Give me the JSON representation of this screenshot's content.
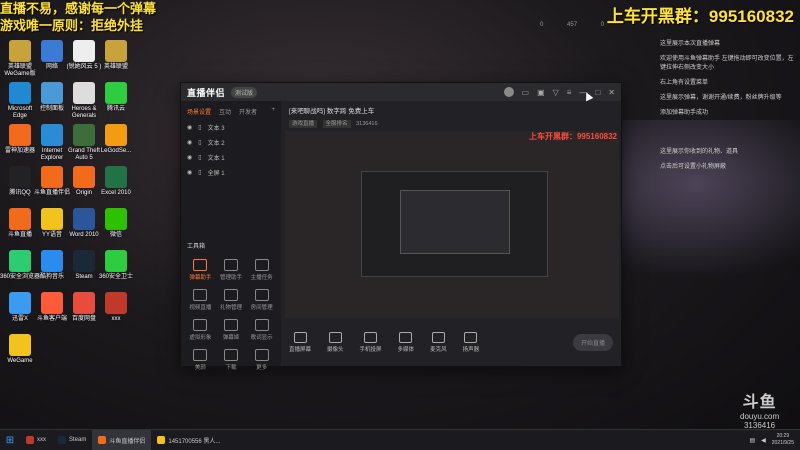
{
  "overlay": {
    "top_left_line1": "直播不易，感谢每一个弹幕",
    "top_left_line2": "游戏唯一原则：拒绝外挂",
    "top_right": "上车开黑群：995160832"
  },
  "stream_stats": [
    "0",
    "457",
    "0"
  ],
  "desktop_icons": [
    {
      "label": "英雄联盟 WeGame版",
      "color": "#c8a23a"
    },
    {
      "label": "网络",
      "color": "#3a7bd5"
    },
    {
      "label": "(锐她风云 5 )",
      "color": "#eeeeee"
    },
    {
      "label": "英雄联盟",
      "color": "#c8a23a"
    },
    {
      "label": "Microsoft Edge",
      "color": "#1f8ad2"
    },
    {
      "label": "控制面板",
      "color": "#4a9ad8"
    },
    {
      "label": "Heroes & Generals",
      "color": "#dddddd"
    },
    {
      "label": "腾讯云",
      "color": "#2ecc40"
    },
    {
      "label": "雷神加速器",
      "color": "#f26b1d"
    },
    {
      "label": "Internet Explorer",
      "color": "#2a8bd6"
    },
    {
      "label": "Grand Theft Auto 5",
      "color": "#3b6e3b"
    },
    {
      "label": "LeGodSe...",
      "color": "#f39c12"
    },
    {
      "label": "腾讯QQ",
      "color": "#222222"
    },
    {
      "label": "斗鱼直播伴侣",
      "color": "#f26b1d"
    },
    {
      "label": "Origin",
      "color": "#f26b1d"
    },
    {
      "label": "Excel 2010",
      "color": "#217346"
    },
    {
      "label": "斗鱼直播",
      "color": "#f26b1d"
    },
    {
      "label": "YY语音",
      "color": "#f2c21d"
    },
    {
      "label": "Word 2010",
      "color": "#2b579a"
    },
    {
      "label": "微信",
      "color": "#2dc100"
    },
    {
      "label": "360安全浏览器",
      "color": "#2ecc71"
    },
    {
      "label": "酷狗音乐",
      "color": "#2b8cf0"
    },
    {
      "label": "Steam",
      "color": "#1b2838"
    },
    {
      "label": "360安全卫士",
      "color": "#2ecc40"
    },
    {
      "label": "迅雷X",
      "color": "#3a9bf0"
    },
    {
      "label": "斗鱼客户端",
      "color": "#ff5a3a"
    },
    {
      "label": "百度网盘",
      "color": "#e74c3c"
    },
    {
      "label": "xxx",
      "color": "#c0392b"
    },
    {
      "label": "WeGame",
      "color": "#f2c21d"
    }
  ],
  "chat_panel": [
    "这里展示本次直播弹幕",
    "欢迎使用斗鱼弹幕助手 左键拖动即可改变位置，左键拉伸右侧改变大小",
    "右上角有设置菜单",
    "这里展示弹幕，谢谢开通/续费，粉丝牌升级等",
    "添加弹幕助手成功",
    "这里展示你收到的礼物、道具",
    "点击后可设置小礼物屏蔽"
  ],
  "app": {
    "title": "直播伴侣",
    "version": "测试版",
    "side_tabs": [
      "场景设置",
      "互动",
      "开发者"
    ],
    "scenes": [
      "文本 3",
      "文本 2",
      "文本 1",
      "全屏 1"
    ],
    "toolbox_title": "工具箱",
    "tools": [
      {
        "label": "弹幕助手",
        "active": true
      },
      {
        "label": "管理助手",
        "active": false
      },
      {
        "label": "主播任务",
        "active": false
      },
      {
        "label": "视频直播",
        "active": false
      },
      {
        "label": "礼物管理",
        "active": false
      },
      {
        "label": "房间管理",
        "active": false
      },
      {
        "label": "虚拟形象",
        "active": false
      },
      {
        "label": "弹幕姬",
        "active": false
      },
      {
        "label": "歌词显示",
        "active": false
      },
      {
        "label": "美颜",
        "active": false
      },
      {
        "label": "下载",
        "active": false
      },
      {
        "label": "更多",
        "active": false
      }
    ],
    "room_title": "[来吧聊战吗] 数字跨 免费上车",
    "room_sub_chips": [
      "游戏直播",
      "全服排名"
    ],
    "room_id": "3136416",
    "preview_overlay": "上车开黑群：995160832",
    "bottom_buttons": [
      "直播屏幕",
      "摄像头",
      "手机投屏",
      "多媒体",
      "麦克风",
      "扬声器"
    ],
    "start_live": "开始直播"
  },
  "watermark": {
    "logo": "斗鱼",
    "site": "douyu.com",
    "room": "3136416"
  },
  "taskbar": {
    "items": [
      {
        "label": "xxx",
        "color": "#c0392b",
        "active": false
      },
      {
        "label": "Steam",
        "color": "#1b2838",
        "active": false
      },
      {
        "label": "斗鱼直播伴侣",
        "color": "#f26b1d",
        "active": true
      },
      {
        "label": "1451700556 黑人...",
        "color": "#f2c21d",
        "active": false
      }
    ],
    "time": "20:29",
    "date": "2021/9/25"
  }
}
